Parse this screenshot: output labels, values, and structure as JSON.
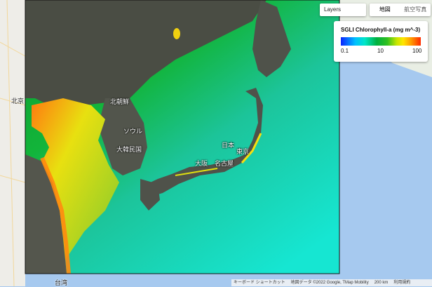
{
  "layers_button": "Layers",
  "map_types": [
    "地図",
    "航空写真"
  ],
  "legend": {
    "title": "SGLI Chlorophyll-a (mg m^-3)",
    "tick_min": "0.1",
    "tick_mid": "10",
    "tick_max": "100"
  },
  "place_labels": {
    "north_korea": "北朝鮮",
    "seoul": "ソウル",
    "south_korea": "大韓民国",
    "japan": "日本",
    "tokyo": "東京",
    "osaka": "大阪",
    "nagoya": "名古屋",
    "beijing": "北京",
    "taiwan": "台湾"
  },
  "footer": {
    "shortcuts": "キーボード ショートカット",
    "attribution": "地図データ ©2022 Google, TMap Mobility",
    "scale": "200 km",
    "terms": "利用規約"
  }
}
